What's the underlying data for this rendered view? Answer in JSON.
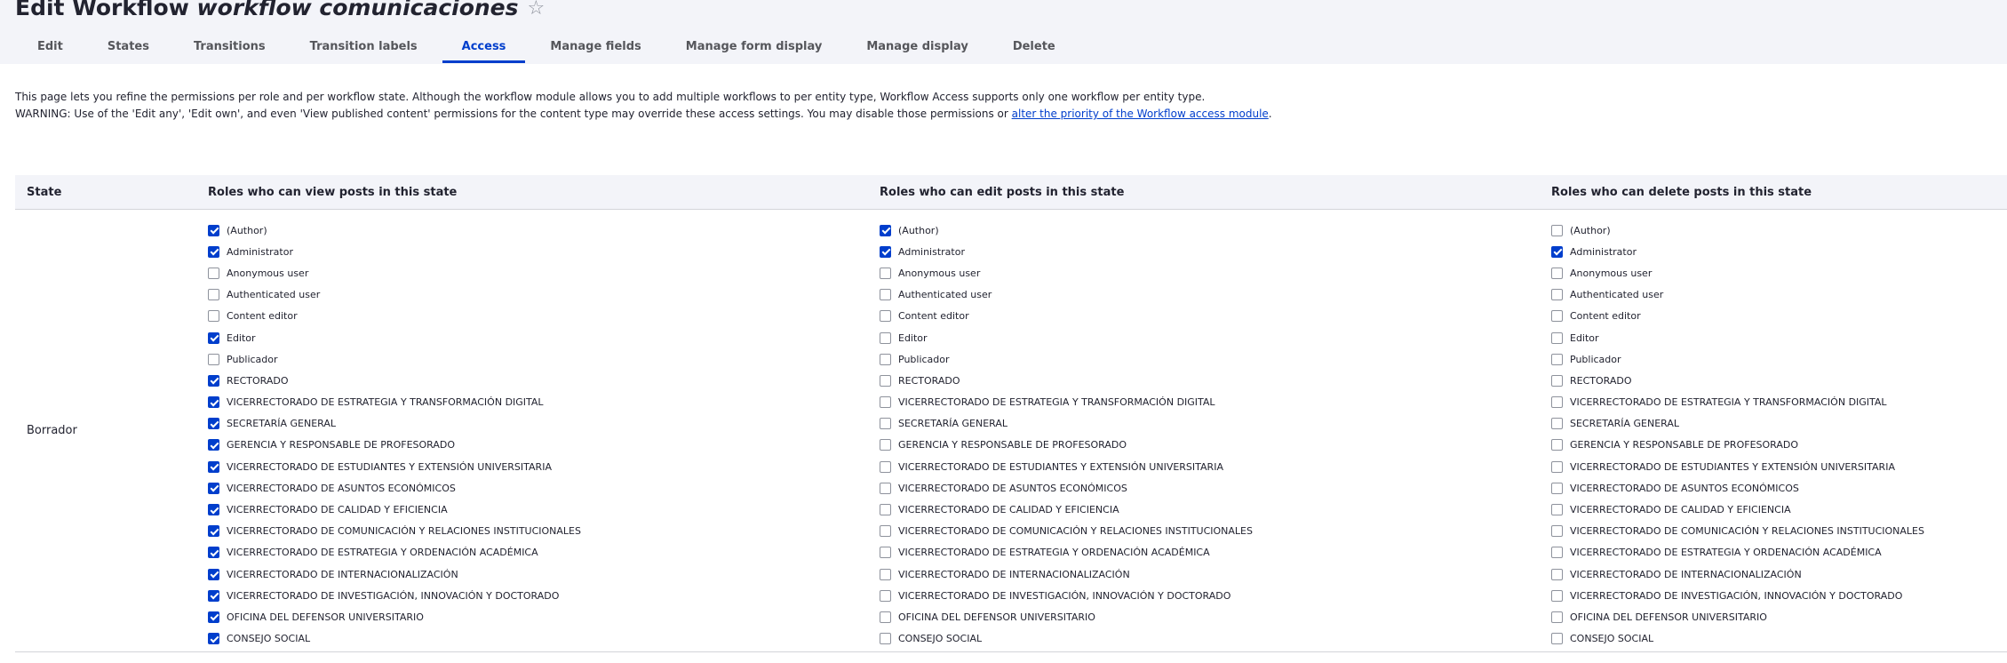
{
  "header": {
    "title_prefix": "Edit Workflow",
    "title_name": "workflow comunicaciones",
    "star_icon": "☆"
  },
  "tabs": [
    {
      "label": "Edit",
      "active": false
    },
    {
      "label": "States",
      "active": false
    },
    {
      "label": "Transitions",
      "active": false
    },
    {
      "label": "Transition labels",
      "active": false
    },
    {
      "label": "Access",
      "active": true
    },
    {
      "label": "Manage fields",
      "active": false
    },
    {
      "label": "Manage form display",
      "active": false
    },
    {
      "label": "Manage display",
      "active": false
    },
    {
      "label": "Delete",
      "active": false
    }
  ],
  "description": {
    "line1": "This page lets you refine the permissions per role and per workflow state. Although the workflow module allows you to add multiple workflows to per entity type, Workflow Access supports only one workflow per entity type.",
    "line2_prefix": "WARNING: Use of the 'Edit any', 'Edit own', and even 'View published content' permissions for the content type may override these access settings. You may disable those permissions or ",
    "line2_link": "alter the priority of the Workflow access module",
    "line2_suffix": "."
  },
  "table": {
    "headers": {
      "state": "State",
      "view": "Roles who can view posts in this state",
      "edit": "Roles who can edit posts in this state",
      "delete": "Roles who can delete posts in this state"
    },
    "roles": [
      "(Author)",
      "Administrator",
      "Anonymous user",
      "Authenticated user",
      "Content editor",
      "Editor",
      "Publicador",
      "RECTORADO",
      "VICERRECTORADO DE ESTRATEGIA Y TRANSFORMACIÓN DIGITAL",
      "SECRETARÍA GENERAL",
      "GERENCIA Y RESPONSABLE DE PROFESORADO",
      "VICERRECTORADO DE ESTUDIANTES Y EXTENSIÓN UNIVERSITARIA",
      "VICERRECTORADO DE ASUNTOS ECONÓMICOS",
      "VICERRECTORADO DE CALIDAD Y EFICIENCIA",
      "VICERRECTORADO DE COMUNICACIÓN Y RELACIONES INSTITUCIONALES",
      "VICERRECTORADO DE ESTRATEGIA Y ORDENACIÓN ACADÉMICA",
      "VICERRECTORADO DE INTERNACIONALIZACIÓN",
      "VICERRECTORADO DE INVESTIGACIÓN, INNOVACIÓN Y DOCTORADO",
      "OFICINA DEL DEFENSOR UNIVERSITARIO",
      "CONSEJO SOCIAL"
    ],
    "rows": [
      {
        "state": "Borrador",
        "view": [
          true,
          true,
          false,
          false,
          false,
          true,
          false,
          true,
          true,
          true,
          true,
          true,
          true,
          true,
          true,
          true,
          true,
          true,
          true,
          true
        ],
        "edit": [
          true,
          true,
          false,
          false,
          false,
          false,
          false,
          false,
          false,
          false,
          false,
          false,
          false,
          false,
          false,
          false,
          false,
          false,
          false,
          false
        ],
        "delete": [
          false,
          true,
          false,
          false,
          false,
          false,
          false,
          false,
          false,
          false,
          false,
          false,
          false,
          false,
          false,
          false,
          false,
          false,
          false,
          false
        ]
      }
    ]
  }
}
